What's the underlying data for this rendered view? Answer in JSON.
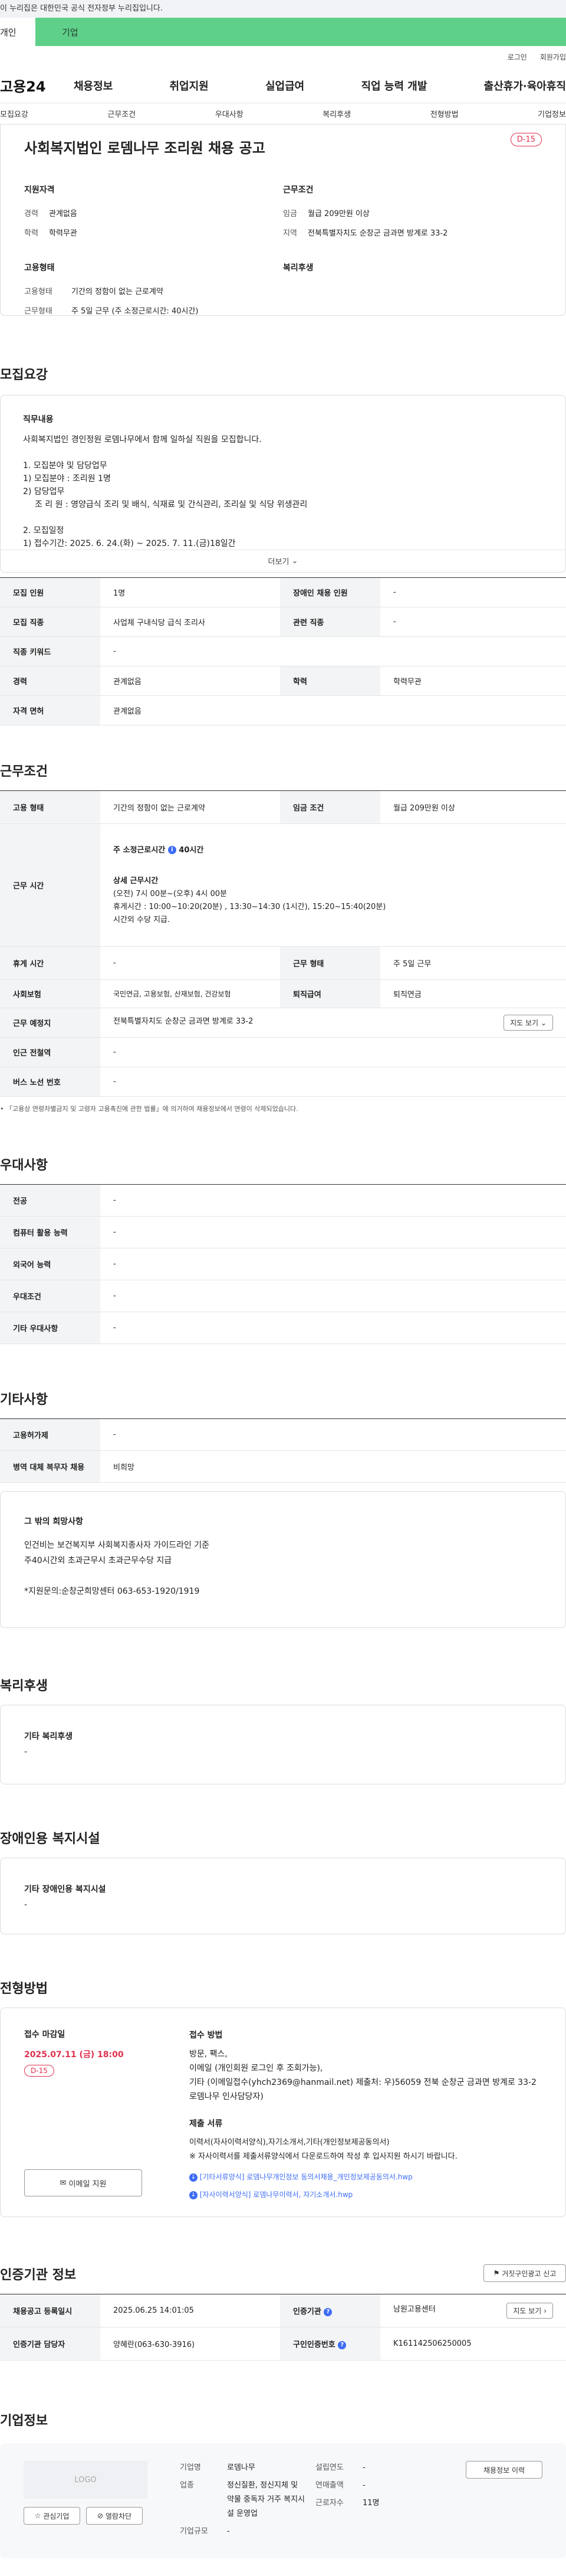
{
  "gov_banner": "이 누리집은 대한민국 공식 전자정부 누리집입니다.",
  "top_tabs": {
    "personal": "개인",
    "company": "기업"
  },
  "util": {
    "login": "로그인",
    "join": "회원가입"
  },
  "logo": "고용24",
  "gnb": [
    "채용정보",
    "취업지원",
    "실업급여",
    "직업 능력 개발",
    "출산휴가·육아휴직"
  ],
  "subtabs": [
    "모집요강",
    "근무조건",
    "우대사항",
    "복리후생",
    "전형방법",
    "기업정보"
  ],
  "job": {
    "title": "사회복지법인 로뎀나무 조리원 채용 공고",
    "dday": "D-15",
    "qual_h": "지원자격",
    "qual": [
      {
        "k": "경력",
        "v": "관계없음"
      },
      {
        "k": "학력",
        "v": "학력무관"
      }
    ],
    "cond_h": "근무조건",
    "cond": [
      {
        "k": "임금",
        "v": "월급 209만원 이상"
      },
      {
        "k": "지역",
        "v": "전북특별자치도 순창군 금과면 방계로 33-2"
      }
    ],
    "emp_h": "고용형태",
    "emp": [
      {
        "k": "고용형태",
        "v": "기간의 정함이 없는 근로계약"
      },
      {
        "k": "근무형태",
        "v": "주 5일 근무 (주 소정근로시간: 40시간)"
      }
    ],
    "welfare_h": "복리후생"
  },
  "recruit": {
    "title": "모집요강",
    "desc_h": "직무내용",
    "desc_lines": [
      "사회복지법인 경인정원 로뎀나무에서 함께 일하실 직원을 모집합니다.",
      "",
      "1. 모집분야 및 담당업무",
      " 1) 모집분야 : 조리원 1명",
      " 2) 담당업무",
      "    조 리 원 : 영양급식 조리 및 배식, 식재료 및 간식관리, 조리실 및 식당 위생관리",
      "",
      "2. 모집일정",
      " 1) 접수기간: 2025. 6. 24.(화) ~ 2025. 7. 11.(금)18일간"
    ],
    "more": "더보기",
    "rows": [
      {
        "k": "모집 인원",
        "v": "1명",
        "k2": "장애인 채용 인원",
        "v2": "-"
      },
      {
        "k": "모집 직종",
        "v": "사업체 구내식당 급식 조리사",
        "k2": "관련 직종",
        "v2": "-"
      },
      {
        "k": "직종 키워드",
        "v": "-"
      },
      {
        "k": "경력",
        "v": "관계없음",
        "k2": "학력",
        "v2": "학력무관"
      },
      {
        "k": "자격 면허",
        "v": "관계없음"
      }
    ]
  },
  "work": {
    "title": "근무조건",
    "type_k": "고용 형태",
    "type_v": "기간의 정함이 없는 근로계약",
    "wage_k": "임금 조건",
    "wage_v": "월급 209만원 이상",
    "time_k": "근무 시간",
    "time_main": "주 소정근로시간",
    "time_hours": "40시간",
    "time_detail_h": "상세 근무시간",
    "time_detail": [
      "(오전) 7시 00분~(오후) 4시 00분",
      "휴게시간 : 10:00~10:20(20분) , 13:30~14:30 (1시간), 15:20~15:40(20분)",
      "시간외 수당 지급."
    ],
    "rest_k": "휴게 시간",
    "rest_v": "-",
    "form_k": "근무 형태",
    "form_v": "주 5일 근무",
    "ins_k": "사회보험",
    "ins_v": "국민연금, 고용보험, 산재보험, 건강보험",
    "ret_k": "퇴직급여",
    "ret_v": "퇴직연금",
    "place_k": "근무 예정지",
    "place_v": "전북특별자치도 순창군 금과면 방계로 33-2",
    "map": "지도 보기",
    "sub_k": "인근 전철역",
    "sub_v": "-",
    "bus_k": "버스 노선 번호",
    "bus_v": "-",
    "note": "「고용상 연령차별금지 및 고령자 고용촉진에 관한 법률」에 의거하여 채용정보에서 연령이 삭제되었습니다."
  },
  "pref": {
    "title": "우대사항",
    "rows": [
      {
        "k": "전공",
        "v": "-"
      },
      {
        "k": "컴퓨터 활용 능력",
        "v": "-"
      },
      {
        "k": "외국어 능력",
        "v": "-"
      },
      {
        "k": "우대조건",
        "v": "-"
      },
      {
        "k": "기타 우대사항",
        "v": "-"
      }
    ]
  },
  "etc": {
    "title": "기타사항",
    "rows": [
      {
        "k": "고용허가제",
        "v": "-"
      },
      {
        "k": "병역 대체 복무자 채용",
        "v": "비희망"
      }
    ],
    "box_h": "그 밖의 희망사항",
    "box_lines": [
      "인건비는 보건복지부 사회복지종사자 가이드라인 기준",
      "주40시간외 초과근무시 초과근무수당 지급",
      "",
      "*지원문의:순창군희망센터 063-653-1920/1919"
    ]
  },
  "welfare": {
    "title": "복리후생",
    "h": "기타 복리후생",
    "v": "-"
  },
  "disabled": {
    "title": "장애인용 복지시설",
    "h": "기타 장애인용 복지시설",
    "v": "-"
  },
  "apply": {
    "title": "전형방법",
    "deadline_h": "접수 마감일",
    "deadline": "2025.07.11 (금) 18:00",
    "dday": "D-15",
    "email_btn": "이메일 지원",
    "method_h": "접수 방법",
    "method_lines": [
      "방문, 팩스,",
      "이메일 (개인회원 로그인 후 조회가능),",
      "기타 (이메일접수(yhch2369@hanmail.net) 제출처: 우)56059 전북 순창군 금과면 방계로 33-2 로뎀나무 인사담당자)"
    ],
    "docs_h": "제출 서류",
    "docs_lines": [
      "이력서(자사이력서양식),자기소개서,기타(개인정보제공동의서)",
      "※ 자사이력서를 제출서류양식에서 다운로드하여 작성 후 입사지원 하시기 바랍니다."
    ],
    "files": [
      "[기타서류양식] 로뎀나무개인정보 동의서채용_개인정보제공동의서.hwp",
      "[자사이력서양식] 로뎀나무이력서, 자기소개서.hwp"
    ]
  },
  "agency": {
    "title": "인증기관 정보",
    "report": "거짓구인광고 신고",
    "reg_k": "채용공고 등록일시",
    "reg_v": "2025.06.25 14:01:05",
    "org_k": "인증기관",
    "org_v": "남원고용센터",
    "staff_k": "인증기관 담당자",
    "staff_v": "양혜란(063-630-3916)",
    "num_k": "구인인증번호",
    "num_v": "K161142506250005",
    "map": "지도 보기"
  },
  "company": {
    "title": "기업정보",
    "logo": "LOGO",
    "fav": "관심기업",
    "block": "열람차단",
    "history": "채용정보 이력",
    "rows": [
      {
        "k": "기업명",
        "v": "로뎀나무",
        "k2": "설립연도",
        "v2": "-"
      },
      {
        "k": "업종",
        "v": "정신질환, 정신지체 및 약물 중독자 거주 복지시설 운영업",
        "k2": "연매출액",
        "v2": "-"
      },
      {
        "k": "",
        "v": "",
        "k2": "근로자수",
        "v2": "11명"
      },
      {
        "k": "기업규모",
        "v": "-",
        "k2": "",
        "v2": ""
      }
    ]
  }
}
